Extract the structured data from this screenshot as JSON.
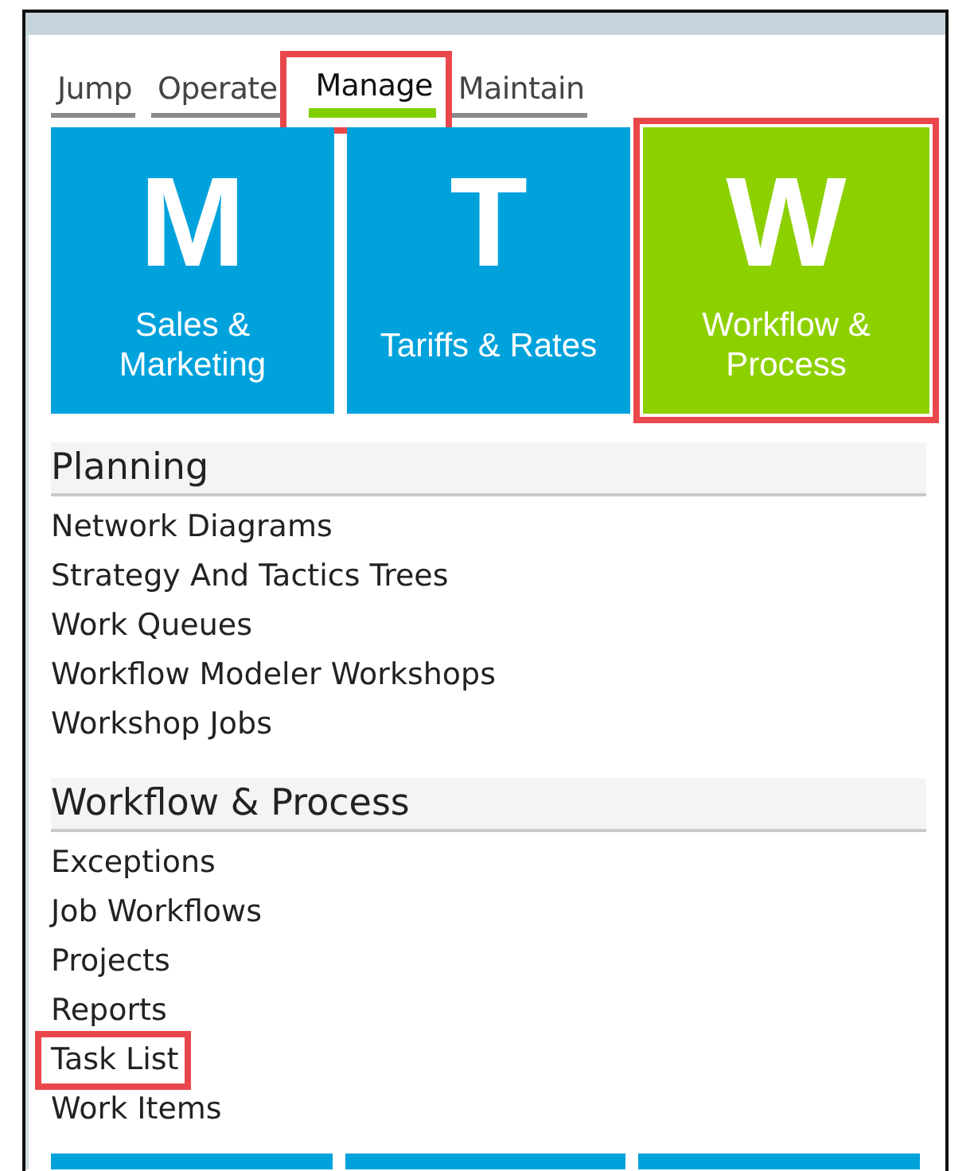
{
  "tabs": [
    {
      "label": "Jump",
      "selected": false,
      "highlighted": false
    },
    {
      "label": "Operate",
      "selected": false,
      "highlighted": false
    },
    {
      "label": "Manage",
      "selected": true,
      "highlighted": true
    },
    {
      "label": "Maintain",
      "selected": false,
      "highlighted": false
    }
  ],
  "tiles": [
    {
      "letter": "M",
      "label": "Sales & Marketing",
      "color": "#00a2dc",
      "highlighted": false
    },
    {
      "letter": "T",
      "label": "Tariffs & Rates",
      "color": "#00a2dc",
      "highlighted": false
    },
    {
      "letter": "W",
      "label": "Workflow & Process",
      "color": "#8dd000",
      "highlighted": true
    }
  ],
  "sections": [
    {
      "title": "Planning",
      "items": [
        {
          "label": "Network Diagrams",
          "highlighted": false
        },
        {
          "label": "Strategy And Tactics Trees",
          "highlighted": false
        },
        {
          "label": "Work Queues",
          "highlighted": false
        },
        {
          "label": "Workflow Modeler Workshops",
          "highlighted": false
        },
        {
          "label": "Workshop Jobs",
          "highlighted": false
        }
      ]
    },
    {
      "title": "Workflow & Process",
      "items": [
        {
          "label": "Exceptions",
          "highlighted": false
        },
        {
          "label": "Job Workflows",
          "highlighted": false
        },
        {
          "label": "Projects",
          "highlighted": false
        },
        {
          "label": "Reports",
          "highlighted": false
        },
        {
          "label": "Task List",
          "highlighted": true
        },
        {
          "label": "Work Items",
          "highlighted": false
        }
      ]
    }
  ]
}
